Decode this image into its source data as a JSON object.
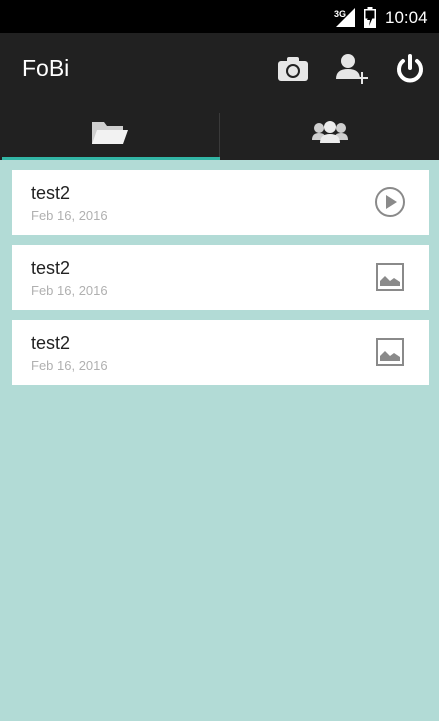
{
  "status_bar": {
    "network": "3G",
    "time": "10:04",
    "signal_icon": "signal-icon",
    "battery_icon": "battery-icon"
  },
  "action_bar": {
    "title": "FoBi",
    "actions": [
      {
        "icon": "camera-icon"
      },
      {
        "icon": "add-user-icon"
      },
      {
        "icon": "power-icon"
      }
    ]
  },
  "tabs": [
    {
      "icon": "folder-open-icon",
      "selected": true
    },
    {
      "icon": "group-icon",
      "selected": false
    }
  ],
  "items": [
    {
      "name": "test2",
      "date": "Feb 16, 2016",
      "type_icon": "play-icon"
    },
    {
      "name": "test2",
      "date": "Feb 16, 2016",
      "type_icon": "image-icon"
    },
    {
      "name": "test2",
      "date": "Feb 16, 2016",
      "type_icon": "image-icon"
    }
  ],
  "colors": {
    "status_bar": "#000000",
    "action_bar": "#212121",
    "tab_indicator": "#33b5a5",
    "list_background": "#b2dbd6",
    "card": "#ffffff"
  }
}
